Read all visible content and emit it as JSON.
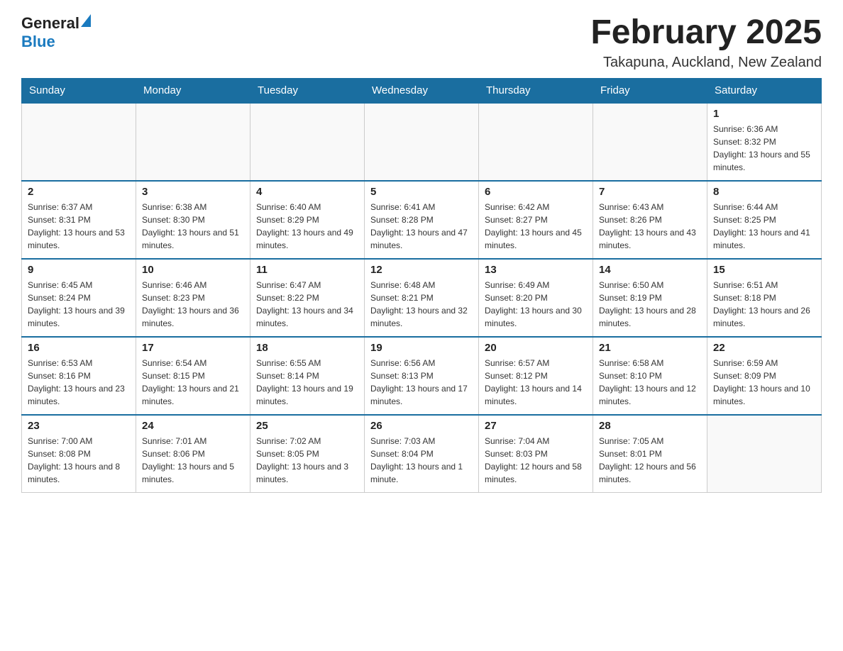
{
  "header": {
    "logo_general": "General",
    "logo_blue": "Blue",
    "title": "February 2025",
    "location": "Takapuna, Auckland, New Zealand"
  },
  "days_of_week": [
    "Sunday",
    "Monday",
    "Tuesday",
    "Wednesday",
    "Thursday",
    "Friday",
    "Saturday"
  ],
  "weeks": [
    {
      "days": [
        {
          "num": "",
          "info": ""
        },
        {
          "num": "",
          "info": ""
        },
        {
          "num": "",
          "info": ""
        },
        {
          "num": "",
          "info": ""
        },
        {
          "num": "",
          "info": ""
        },
        {
          "num": "",
          "info": ""
        },
        {
          "num": "1",
          "info": "Sunrise: 6:36 AM\nSunset: 8:32 PM\nDaylight: 13 hours and 55 minutes."
        }
      ]
    },
    {
      "days": [
        {
          "num": "2",
          "info": "Sunrise: 6:37 AM\nSunset: 8:31 PM\nDaylight: 13 hours and 53 minutes."
        },
        {
          "num": "3",
          "info": "Sunrise: 6:38 AM\nSunset: 8:30 PM\nDaylight: 13 hours and 51 minutes."
        },
        {
          "num": "4",
          "info": "Sunrise: 6:40 AM\nSunset: 8:29 PM\nDaylight: 13 hours and 49 minutes."
        },
        {
          "num": "5",
          "info": "Sunrise: 6:41 AM\nSunset: 8:28 PM\nDaylight: 13 hours and 47 minutes."
        },
        {
          "num": "6",
          "info": "Sunrise: 6:42 AM\nSunset: 8:27 PM\nDaylight: 13 hours and 45 minutes."
        },
        {
          "num": "7",
          "info": "Sunrise: 6:43 AM\nSunset: 8:26 PM\nDaylight: 13 hours and 43 minutes."
        },
        {
          "num": "8",
          "info": "Sunrise: 6:44 AM\nSunset: 8:25 PM\nDaylight: 13 hours and 41 minutes."
        }
      ]
    },
    {
      "days": [
        {
          "num": "9",
          "info": "Sunrise: 6:45 AM\nSunset: 8:24 PM\nDaylight: 13 hours and 39 minutes."
        },
        {
          "num": "10",
          "info": "Sunrise: 6:46 AM\nSunset: 8:23 PM\nDaylight: 13 hours and 36 minutes."
        },
        {
          "num": "11",
          "info": "Sunrise: 6:47 AM\nSunset: 8:22 PM\nDaylight: 13 hours and 34 minutes."
        },
        {
          "num": "12",
          "info": "Sunrise: 6:48 AM\nSunset: 8:21 PM\nDaylight: 13 hours and 32 minutes."
        },
        {
          "num": "13",
          "info": "Sunrise: 6:49 AM\nSunset: 8:20 PM\nDaylight: 13 hours and 30 minutes."
        },
        {
          "num": "14",
          "info": "Sunrise: 6:50 AM\nSunset: 8:19 PM\nDaylight: 13 hours and 28 minutes."
        },
        {
          "num": "15",
          "info": "Sunrise: 6:51 AM\nSunset: 8:18 PM\nDaylight: 13 hours and 26 minutes."
        }
      ]
    },
    {
      "days": [
        {
          "num": "16",
          "info": "Sunrise: 6:53 AM\nSunset: 8:16 PM\nDaylight: 13 hours and 23 minutes."
        },
        {
          "num": "17",
          "info": "Sunrise: 6:54 AM\nSunset: 8:15 PM\nDaylight: 13 hours and 21 minutes."
        },
        {
          "num": "18",
          "info": "Sunrise: 6:55 AM\nSunset: 8:14 PM\nDaylight: 13 hours and 19 minutes."
        },
        {
          "num": "19",
          "info": "Sunrise: 6:56 AM\nSunset: 8:13 PM\nDaylight: 13 hours and 17 minutes."
        },
        {
          "num": "20",
          "info": "Sunrise: 6:57 AM\nSunset: 8:12 PM\nDaylight: 13 hours and 14 minutes."
        },
        {
          "num": "21",
          "info": "Sunrise: 6:58 AM\nSunset: 8:10 PM\nDaylight: 13 hours and 12 minutes."
        },
        {
          "num": "22",
          "info": "Sunrise: 6:59 AM\nSunset: 8:09 PM\nDaylight: 13 hours and 10 minutes."
        }
      ]
    },
    {
      "days": [
        {
          "num": "23",
          "info": "Sunrise: 7:00 AM\nSunset: 8:08 PM\nDaylight: 13 hours and 8 minutes."
        },
        {
          "num": "24",
          "info": "Sunrise: 7:01 AM\nSunset: 8:06 PM\nDaylight: 13 hours and 5 minutes."
        },
        {
          "num": "25",
          "info": "Sunrise: 7:02 AM\nSunset: 8:05 PM\nDaylight: 13 hours and 3 minutes."
        },
        {
          "num": "26",
          "info": "Sunrise: 7:03 AM\nSunset: 8:04 PM\nDaylight: 13 hours and 1 minute."
        },
        {
          "num": "27",
          "info": "Sunrise: 7:04 AM\nSunset: 8:03 PM\nDaylight: 12 hours and 58 minutes."
        },
        {
          "num": "28",
          "info": "Sunrise: 7:05 AM\nSunset: 8:01 PM\nDaylight: 12 hours and 56 minutes."
        },
        {
          "num": "",
          "info": ""
        }
      ]
    }
  ]
}
